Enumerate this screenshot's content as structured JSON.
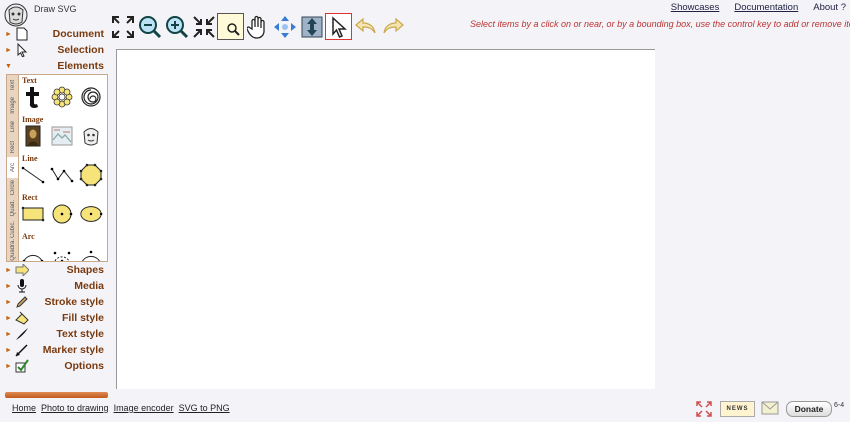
{
  "app": {
    "title": "Draw SVG"
  },
  "toolbar": {
    "tools": [
      {
        "icon": "fit-screen-icon"
      },
      {
        "icon": "zoom-out-icon"
      },
      {
        "icon": "zoom-in-icon"
      },
      {
        "icon": "shrink-icon"
      },
      {
        "icon": "zoom-box-icon"
      },
      {
        "icon": "pan-hand-icon"
      },
      {
        "icon": "move-arrows-icon"
      },
      {
        "icon": "resize-vertical-icon"
      },
      {
        "icon": "select-pointer-icon"
      },
      {
        "icon": "undo-icon"
      },
      {
        "icon": "redo-icon"
      }
    ],
    "hint": "Select items by a click on or near, or by a bounding box, use the control key to add or remove items"
  },
  "top_links": {
    "showcases": "Showcases",
    "documentation": "Documentation",
    "about": "About ?"
  },
  "sidebar": {
    "sections_top": [
      {
        "label": "Document",
        "icon": "document-icon",
        "state": "collapsed"
      },
      {
        "label": "Selection",
        "icon": "pointer-icon",
        "state": "collapsed"
      },
      {
        "label": "Elements",
        "icon": "",
        "state": "expanded"
      }
    ],
    "elements_panel": {
      "vertical_tabs": [
        "Text",
        "Image",
        "Line",
        "Rect",
        "Arc",
        "Circle",
        "Quad.",
        "Cubic.",
        "Quadra."
      ],
      "groups": [
        "Text",
        "Image",
        "Line",
        "Rect",
        "Arc"
      ]
    },
    "sections_bottom": [
      {
        "label": "Shapes",
        "icon": "shapes-icon"
      },
      {
        "label": "Media",
        "icon": "microphone-icon"
      },
      {
        "label": "Stroke style",
        "icon": "pencil-icon"
      },
      {
        "label": "Fill style",
        "icon": "paint-bucket-icon"
      },
      {
        "label": "Text style",
        "icon": "pen-nib-icon"
      },
      {
        "label": "Marker style",
        "icon": "marker-icon"
      },
      {
        "label": "Options",
        "icon": "checkbox-icon"
      }
    ]
  },
  "bottom_links": [
    "Home",
    "Photo to drawing",
    "Image encoder",
    "SVG to PNG"
  ],
  "bottom_right": {
    "news": "NEWS",
    "donate": "Donate",
    "version": "6-4"
  },
  "colors": {
    "accent": "#7a3a0e",
    "arrow": "#c2620c",
    "hint": "#bb3333"
  }
}
